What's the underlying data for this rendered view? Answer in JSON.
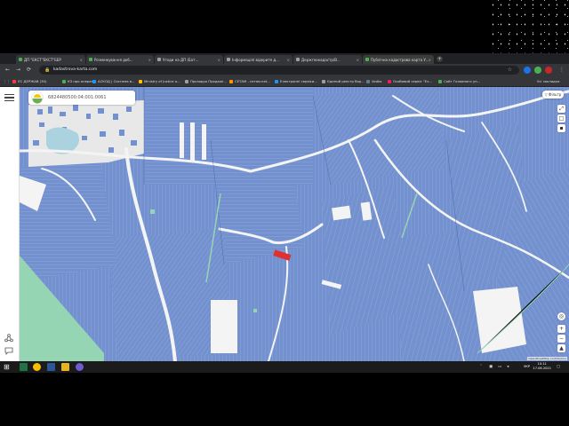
{
  "browser": {
    "tabs": [
      {
        "label": "ДП \"ЕКСТ\"ЕКСТ\"БЕР",
        "color": "#4caf50"
      },
      {
        "label": "Розмежування доб...",
        "color": "#4caf50"
      },
      {
        "label": "Угоди на ДП (Бат...",
        "color": "#9e9e9e"
      },
      {
        "label": "Інформація/ відкрите д...",
        "color": "#9e9e9e"
      },
      {
        "label": "Держгеокадастр/В...",
        "color": "#9e9e9e"
      },
      {
        "label": "Публічна кадастрова карта У...",
        "color": "#4caf50"
      }
    ],
    "url": "kadastrova-karta.com",
    "new_tab_label": "+",
    "back_glyph": "←",
    "forward_glyph": "→",
    "reload_glyph": "⟳",
    "lock_glyph": "🔒",
    "star_glyph": "☆",
    "menu_glyph": "⋮",
    "bookmarks": [
      {
        "label": "ЄС ДЕРЖАВ (30)",
        "color": "#f44336"
      },
      {
        "label": "КЗ про операт...",
        "color": "#4caf50"
      },
      {
        "label": "АСКОД | Система в...",
        "color": "#2196f3"
      },
      {
        "label": "Ministry of Justice o...",
        "color": "#ffc107"
      },
      {
        "label": "Прозорро Продажі...",
        "color": "#9e9e9e"
      },
      {
        "label": "СЕТАМ - сетам.net...",
        "color": "#ff9800"
      },
      {
        "label": "Електронні сервіси...",
        "color": "#2196f3"
      },
      {
        "label": "Єдиний реєстр бор...",
        "color": "#9e9e9e"
      },
      {
        "label": "Vodko",
        "color": "#607d8b"
      },
      {
        "label": "Особовий сервіс \"Ел...",
        "color": "#e91e63"
      },
      {
        "label": "Сайт Головного уп...",
        "color": "#4caf50"
      }
    ],
    "bookmarks_more": "Усі закладки"
  },
  "map_page": {
    "search_value": "6824480500:04:001:0061",
    "filters_label": "Фільтр",
    "zoom_in": "+",
    "zoom_out": "−",
    "attribution": "OpenStreetMap contributors",
    "colors": {
      "parcel": "#7391cf",
      "parcel_line": "#9fb3e0",
      "road": "#f4f4f4",
      "forest": "#96d5b4",
      "selected": "#e03030"
    }
  },
  "taskbar": {
    "language": "УКР",
    "time": "10:11",
    "date": "17.06.2021",
    "start_glyph": "⊞"
  }
}
